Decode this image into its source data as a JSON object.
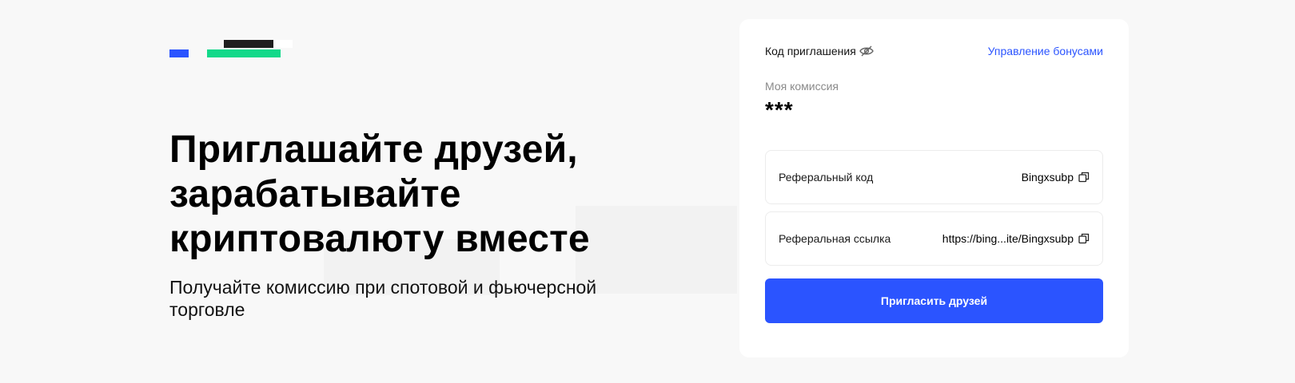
{
  "brand": {
    "colors": {
      "blue": "#2b54ff",
      "green": "#12d98a",
      "dark": "#1f1f1f"
    },
    "logo_icon": "bingx-logo-icon"
  },
  "hero": {
    "title": "Приглашайте друзей, зарабатывайте криптовалюту вместе",
    "subtitle": "Получайте комиссию при спотовой и фьючерсной торговле"
  },
  "card": {
    "invite_code_label": "Код приглашения",
    "invite_code_icon": "eye-slash-icon",
    "manage_bonuses_link": "Управление бонусами",
    "commission_label": "Моя комиссия",
    "commission_value": "***",
    "fields": [
      {
        "label": "Реферальный код",
        "value": "Bingxsubp",
        "icon": "copy-icon"
      },
      {
        "label": "Реферальная ссылка",
        "value": "https://bing...ite/Bingxsubp",
        "icon": "copy-icon"
      }
    ],
    "invite_button": "Пригласить друзей"
  }
}
